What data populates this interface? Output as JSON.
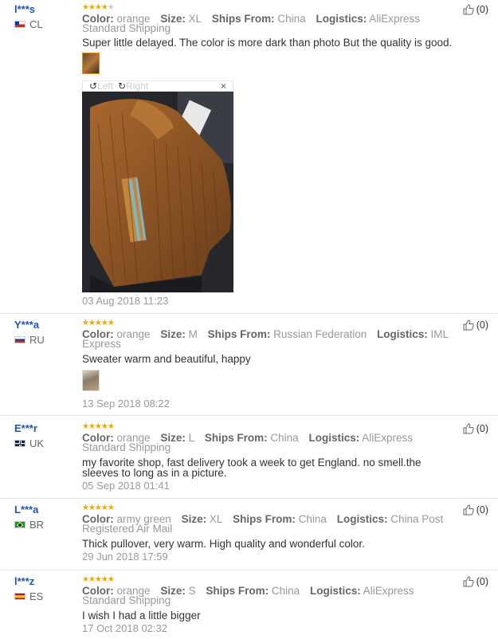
{
  "labels": {
    "color": "Color:",
    "size": "Size:",
    "ships_from": "Ships From:",
    "logistics": "Logistics:"
  },
  "viewer": {
    "left": "Left",
    "right": "Right",
    "close": "×"
  },
  "reviews": [
    {
      "user": "l***s",
      "country": "CL",
      "stars": 4,
      "color": "orange",
      "size": "XL",
      "ships_from": "China",
      "logistics": "AliExpress Standard Shipping",
      "feedback": "Super little delayed. The color is more dark than photo But the quality is good.",
      "date": "03 Aug 2018 11:23",
      "helpful": "(0)"
    },
    {
      "user": "Y***a",
      "country": "RU",
      "stars": 5,
      "color": "orange",
      "size": "M",
      "ships_from": "Russian Federation",
      "logistics": "IML Express",
      "feedback": "Sweater warm and beautiful, happy",
      "date": "13 Sep 2018 08:22",
      "helpful": "(0)"
    },
    {
      "user": "E***r",
      "country": "UK",
      "stars": 5,
      "color": "orange",
      "size": "L",
      "ships_from": "China",
      "logistics": "AliExpress Standard Shipping",
      "feedback": "my favorite shop, fast delivery took a week to get England. no smell.the sleeves to long as in a picture.",
      "date": "05 Sep 2018 01:41",
      "helpful": "(0)"
    },
    {
      "user": "L***a",
      "country": "BR",
      "stars": 5,
      "color": "army green",
      "size": "XL",
      "ships_from": "China",
      "logistics": "China Post Registered Air Mail",
      "feedback": "Thick pullover, very warm. High quality and wonderful color.",
      "date": "29 Jun 2018 17:59",
      "helpful": "(0)"
    },
    {
      "user": "l***z",
      "country": "ES",
      "stars": 5,
      "color": "orange",
      "size": "S",
      "ships_from": "China",
      "logistics": "AliExpress Standard Shipping",
      "feedback": "I wish I had a little bigger",
      "date": "17 Oct 2018 02:32",
      "helpful": "(0)"
    }
  ],
  "colors": {
    "star": "#f6a400",
    "user": "#2154a6",
    "thumb_border": "#e58b20"
  }
}
